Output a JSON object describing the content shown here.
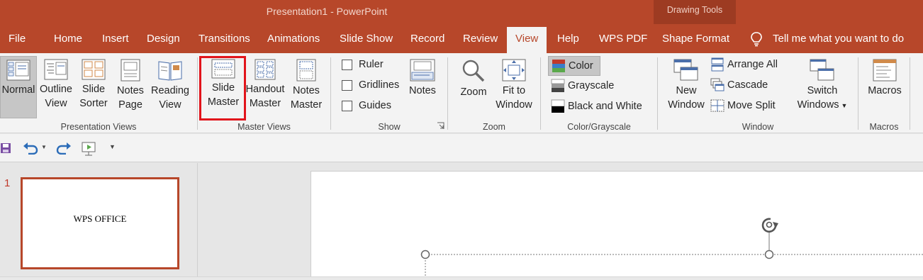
{
  "window": {
    "title": "Presentation1  -  PowerPoint",
    "contextual_group": "Drawing Tools"
  },
  "tabs": [
    {
      "label": "File"
    },
    {
      "label": "Home"
    },
    {
      "label": "Insert"
    },
    {
      "label": "Design"
    },
    {
      "label": "Transitions"
    },
    {
      "label": "Animations"
    },
    {
      "label": "Slide Show"
    },
    {
      "label": "Record"
    },
    {
      "label": "Review"
    },
    {
      "label": "View",
      "active": true
    },
    {
      "label": "Help"
    },
    {
      "label": "WPS PDF"
    },
    {
      "label": "Shape Format"
    }
  ],
  "tell_me": "Tell me what you want to do",
  "ribbon": {
    "presentation_views": {
      "label": "Presentation Views",
      "normal": {
        "line1": "Normal",
        "selected": true
      },
      "outline": {
        "line1": "Outline",
        "line2": "View"
      },
      "sorter": {
        "line1": "Slide",
        "line2": "Sorter"
      },
      "notes_page": {
        "line1": "Notes",
        "line2": "Page"
      },
      "reading": {
        "line1": "Reading",
        "line2": "View"
      }
    },
    "master_views": {
      "label": "Master Views",
      "slide_master": {
        "line1": "Slide",
        "line2": "Master",
        "highlighted": true
      },
      "handout_master": {
        "line1": "Handout",
        "line2": "Master"
      },
      "notes_master": {
        "line1": "Notes",
        "line2": "Master"
      }
    },
    "show": {
      "label": "Show",
      "ruler": {
        "label": "Ruler",
        "checked": false
      },
      "gridlines": {
        "label": "Gridlines",
        "checked": false
      },
      "guides": {
        "label": "Guides",
        "checked": false
      },
      "notes": {
        "line1": "Notes"
      }
    },
    "zoom": {
      "label": "Zoom",
      "zoom": {
        "line1": "Zoom"
      },
      "fit": {
        "line1": "Fit to",
        "line2": "Window"
      }
    },
    "color": {
      "label": "Color/Grayscale",
      "color": {
        "label": "Color",
        "selected": true
      },
      "grayscale": {
        "label": "Grayscale"
      },
      "bw": {
        "label": "Black and White"
      }
    },
    "window": {
      "label": "Window",
      "new_window": {
        "line1": "New",
        "line2": "Window"
      },
      "arrange_all": "Arrange All",
      "cascade": "Cascade",
      "move_split": "Move Split",
      "switch": {
        "line1": "Switch",
        "line2": "Windows"
      }
    },
    "macros": {
      "label": "Macros",
      "macros": {
        "line1": "Macros"
      }
    }
  },
  "slides": {
    "number": "1",
    "thumb_text": "WPS OFFICE"
  },
  "colors": {
    "accent": "#b7472a",
    "highlight": "#e1141b"
  },
  "icons": [
    "save-icon",
    "undo-icon",
    "redo-icon",
    "start-from-beginning-icon",
    "customize-qat-icon",
    "lightbulb-icon",
    "rotate-handle-icon"
  ]
}
